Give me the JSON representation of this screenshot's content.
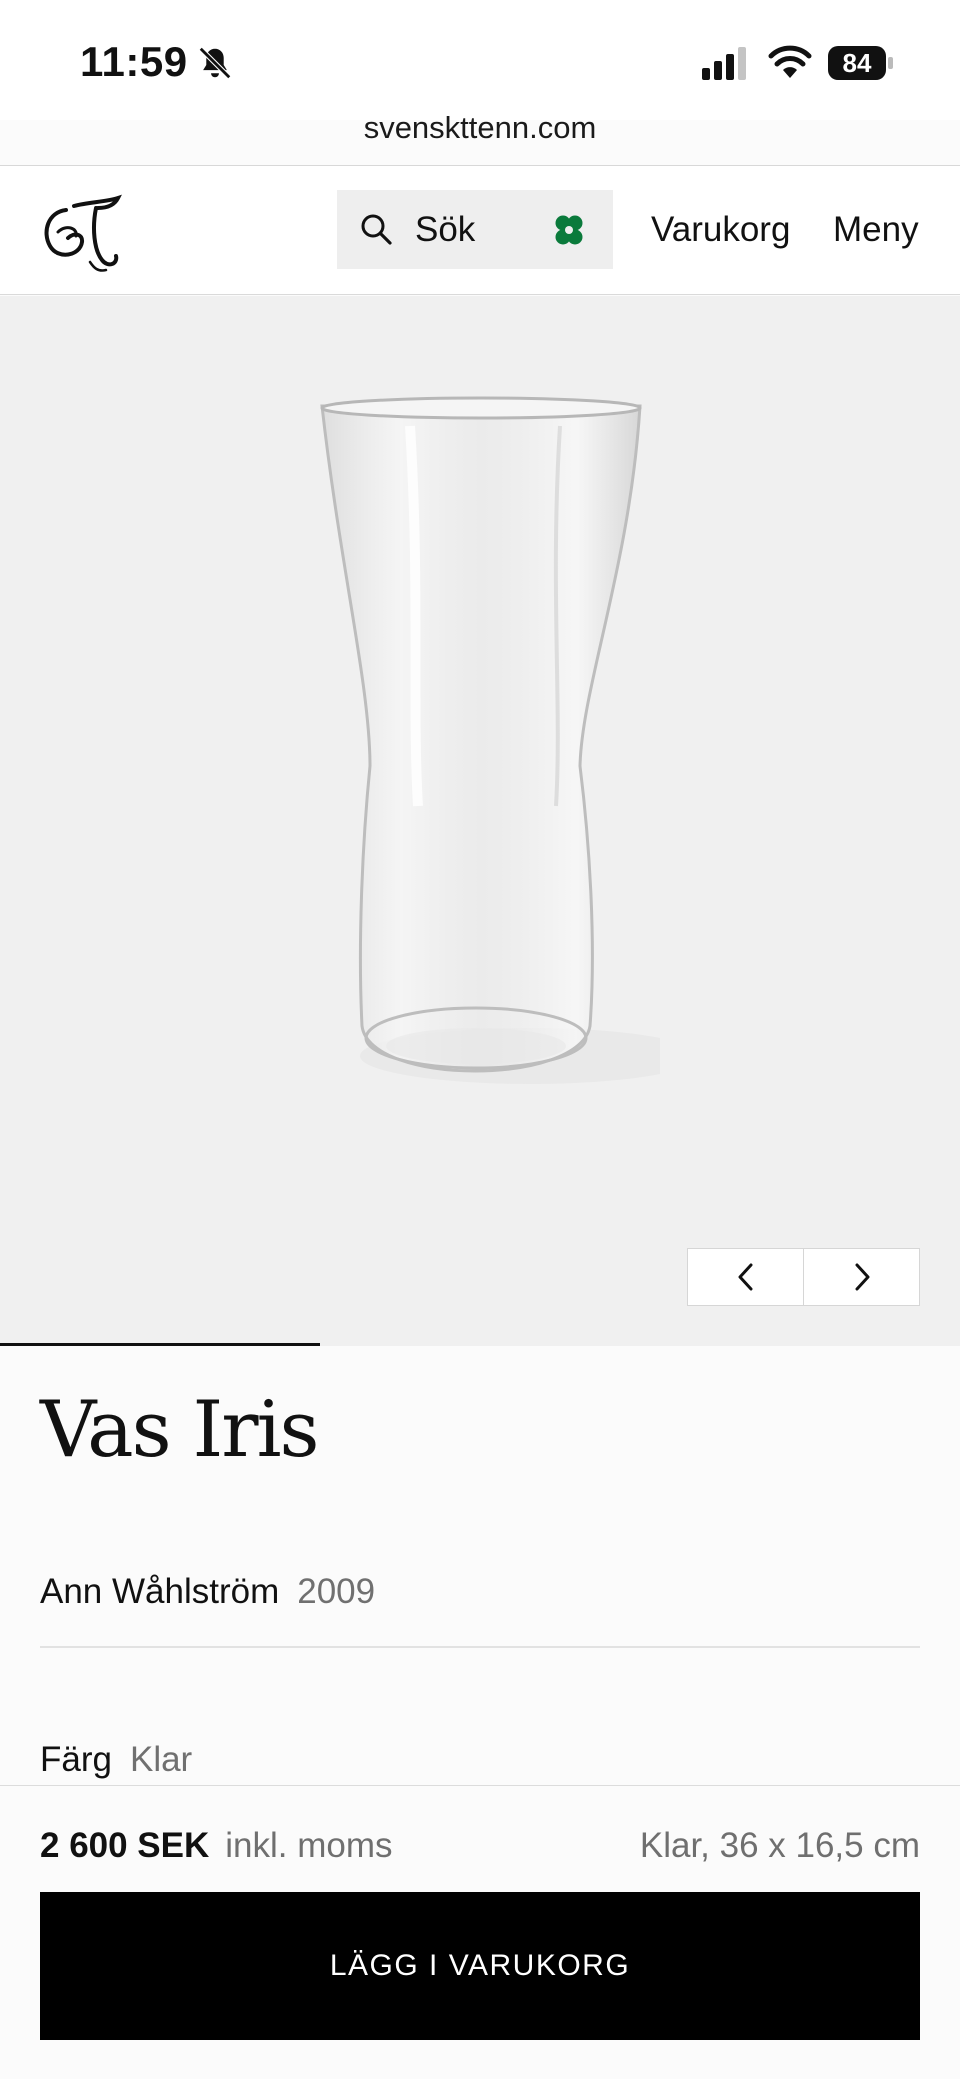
{
  "status_bar": {
    "time": "11:59",
    "battery": "84",
    "icons": [
      "bell-slash-icon",
      "cellular-signal-icon",
      "wifi-icon",
      "battery-icon"
    ]
  },
  "browser": {
    "url": "svenskttenn.com"
  },
  "header": {
    "logo_icon": "svenskt-tenn-monogram-logo",
    "search_label": "Sök",
    "search_icon": "magnifier-icon",
    "clover_icon": "four-leaf-clover-icon",
    "clover_color": "#0a7a3b",
    "cart_label": "Varukorg",
    "menu_label": "Meny"
  },
  "gallery": {
    "background": "#f0f0f0",
    "prev_icon": "chevron-left-icon",
    "next_icon": "chevron-right-icon"
  },
  "product": {
    "title": "Vas Iris",
    "designer": "Ann Wåhlström",
    "year": "2009",
    "color_label": "Färg",
    "color_value": "Klar"
  },
  "purchase": {
    "price": "2 600 SEK",
    "vat_note": "inkl. moms",
    "variant": "Klar, 36 x 16,5 cm",
    "button_label": "LÄGG I VARUKORG"
  }
}
